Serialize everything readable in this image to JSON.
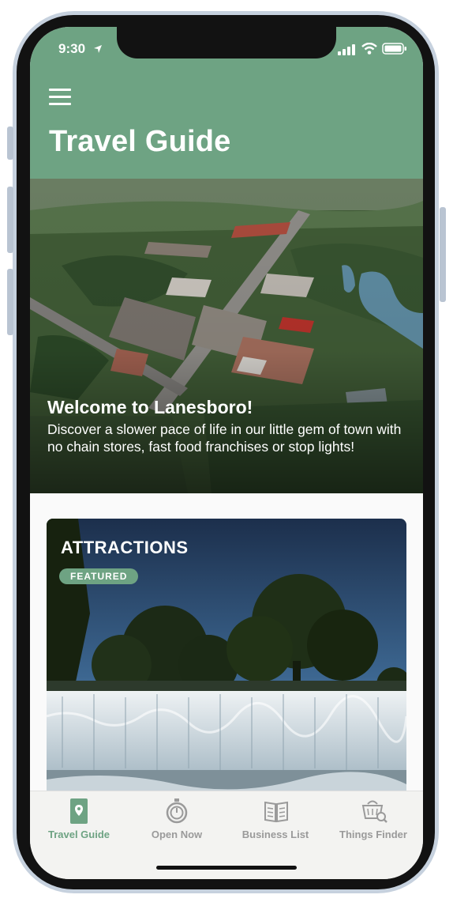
{
  "status_bar": {
    "time": "9:30"
  },
  "header": {
    "title": "Travel Guide",
    "menu_icon": "hamburger-menu-icon"
  },
  "hero": {
    "title": "Welcome to Lanesboro!",
    "description": "Discover a slower pace of life in our little gem of town with no chain stores, fast food franchises or stop lights!"
  },
  "card": {
    "title": "ATTRACTIONS",
    "badge": "FEATURED"
  },
  "tabs": [
    {
      "label": "Travel Guide",
      "icon": "map-guide-icon",
      "active": true
    },
    {
      "label": "Open Now",
      "icon": "stopwatch-icon",
      "active": false
    },
    {
      "label": "Business List",
      "icon": "open-book-icon",
      "active": false
    },
    {
      "label": "Things Finder",
      "icon": "basket-search-icon",
      "active": false
    }
  ],
  "colors": {
    "accent": "#6ea383",
    "tab_inactive": "#9a9a9a",
    "tabbar_bg": "#f3f3f1"
  }
}
